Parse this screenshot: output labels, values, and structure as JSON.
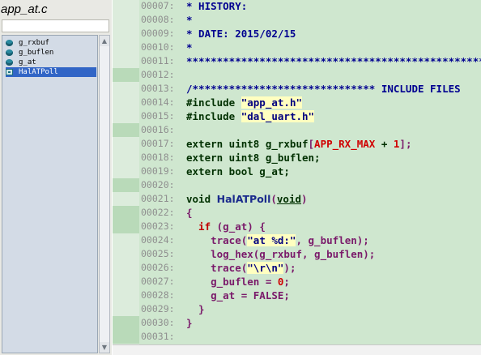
{
  "panel": {
    "title": "app_at.c",
    "symbols": [
      {
        "label": "g_rxbuf",
        "kind": "variable"
      },
      {
        "label": "g_buflen",
        "kind": "variable"
      },
      {
        "label": "g_at",
        "kind": "variable"
      },
      {
        "label": "HalATPoll",
        "kind": "function",
        "selected": true
      }
    ],
    "scroll_up_icon": "triangle-up",
    "scroll_down_icon": "triangle-down"
  },
  "editor": {
    "lines": {
      "n0": "00007:",
      "t0": "* HISTORY:",
      "n1": "00008:",
      "t1": "*",
      "n2": "00009:",
      "t2": "* DATE: 2015/02/15",
      "n3": "00010:",
      "t3": "*",
      "n4": "00011:",
      "t4": "**********************************************************",
      "n5": "00012:",
      "n6": "00013:",
      "t6": "/****************************** INCLUDE FILES",
      "n7": "00014:",
      "t7a": "#include ",
      "t7b": "\"app_at.h\"",
      "n8": "00015:",
      "t8a": "#include ",
      "t8b": "\"dal_uart.h\"",
      "n9": "00016:",
      "n10": "00017:",
      "t10a": "extern uint8 g_rxbuf",
      "t10b": "[",
      "t10c": "APP_RX_MAX",
      "t10d": " + ",
      "t10e": "1",
      "t10f": "];",
      "n11": "00018:",
      "t11": "extern uint8 g_buflen;",
      "n12": "00019:",
      "t12": "extern bool g_at;",
      "n13": "00020:",
      "n14": "00021:",
      "t14a": "void ",
      "t14b": "HalATPoll",
      "t14c": "(",
      "t14d": "void",
      "t14e": ")",
      "n15": "00022:",
      "t15": "{",
      "n16": "00023:",
      "t16a": "  if ",
      "t16b": "(g_at) {",
      "n17": "00024:",
      "t17a": "    trace(",
      "t17b": "\"at %d:\"",
      "t17c": ", g_buflen);",
      "n18": "00025:",
      "t18": "    log_hex(g_rxbuf, g_buflen);",
      "n19": "00026:",
      "t19a": "    trace(",
      "t19b": "\"\\r\\n\"",
      "t19c": ");",
      "n20": "00027:",
      "t20a": "    g_buflen = ",
      "t20b": "0",
      "t20c": ";",
      "n21": "00028:",
      "t21": "    g_at = FALSE;",
      "n22": "00029:",
      "t22": "  }",
      "n23": "00030:",
      "t23": "}",
      "n24": "00031:"
    }
  },
  "colors": {
    "editor_background": "#cfe7cf",
    "gutter_blank_marker": "#b9dab9",
    "line_number": "#8f8f8f",
    "comment": "#000090",
    "string_highlight": "#ffffc0",
    "number": "#d00000",
    "selection": "#3165c6"
  }
}
